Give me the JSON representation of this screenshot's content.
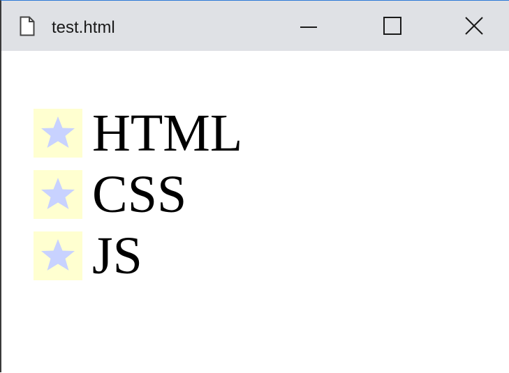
{
  "window": {
    "title": "test.html",
    "controls": {
      "minimize_icon": "minimize-icon",
      "maximize_icon": "maximize-icon",
      "close_icon": "close-icon"
    }
  },
  "list": {
    "items": [
      {
        "label": "HTML",
        "icon": "star-icon"
      },
      {
        "label": "CSS",
        "icon": "star-icon"
      },
      {
        "label": "JS",
        "icon": "star-icon"
      }
    ],
    "bullet_background": "#ffffd0",
    "star_color": "#c8d2ff"
  },
  "colors": {
    "titlebar": "#dfe1e5",
    "content": "#ffffff"
  }
}
